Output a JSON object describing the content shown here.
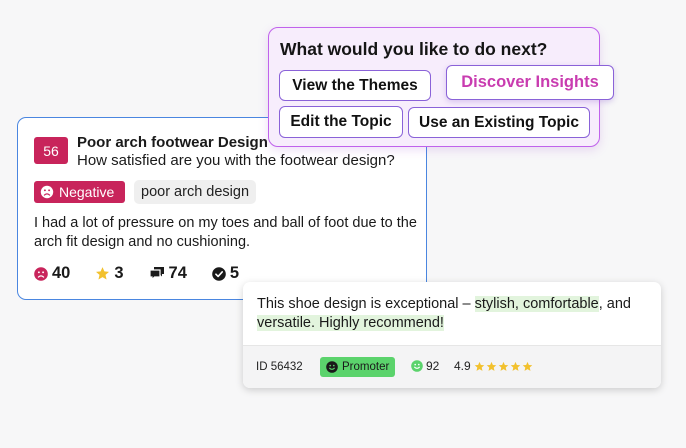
{
  "topic_card": {
    "count": "56",
    "title": "Poor arch footwear Design",
    "question": "How satisfied are you with the footwear design?",
    "sentiment_label": "Negative",
    "tag": "poor arch design",
    "body": "I had a lot of pressure on my toes and ball of foot due to the arch fit design and no cushioning.",
    "stats": {
      "negative": "40",
      "stars": "3",
      "comments": "74",
      "resolved": "5"
    },
    "icons": {
      "sentiment": "sad-face-icon",
      "negative": "sad-face-icon",
      "stars": "star-icon",
      "comments": "chat-bubbles-icon",
      "resolved": "check-circle-icon"
    }
  },
  "next_panel": {
    "title": "What would you like to do next?",
    "actions": {
      "themes": "View the Themes",
      "insights": "Discover Insights",
      "edit": "Edit the Topic",
      "existing": "Use an Existing Topic"
    }
  },
  "review": {
    "text_before": "This shoe design is exceptional – ",
    "highlight_1": "stylish, comfortable",
    "text_middle": ", and ",
    "highlight_2": "versatile. Highly recommend!",
    "id": "ID 56432",
    "badge": "Promoter",
    "score": "92",
    "rating": "4.9",
    "stars_count": 5
  },
  "colors": {
    "accent_red": "#c8245b",
    "accent_purple": "#c062ec",
    "insight_pink": "#c93cb0",
    "promoter_green": "#5bd36c",
    "highlight_green": "#e2f4dd",
    "card_border_blue": "#4a86e0",
    "star_yellow": "#f2c12e"
  }
}
